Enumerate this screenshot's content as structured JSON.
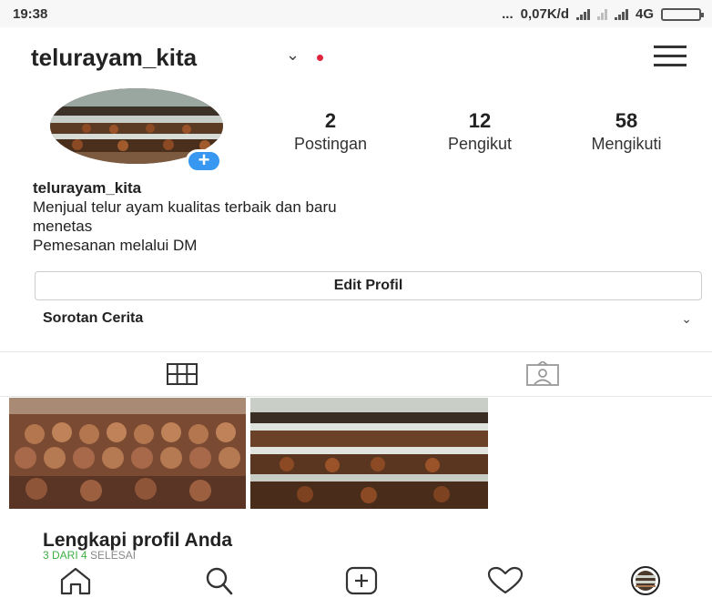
{
  "status_bar": {
    "time": "19:38",
    "dots": "...",
    "speed": "0,07K/d",
    "network": "4G"
  },
  "header": {
    "username": "telurayam_kita",
    "chevron": "⌄"
  },
  "profile": {
    "add_story": "+",
    "stats": [
      {
        "count": "2",
        "label": "Postingan"
      },
      {
        "count": "12",
        "label": "Pengikut"
      },
      {
        "count": "58",
        "label": "Mengikuti"
      }
    ],
    "bio_name": "telurayam_kita",
    "bio_lines": [
      "Menjual telur ayam kualitas terbaik dan baru",
      "menetas",
      "Pemesanan melalui DM"
    ],
    "edit_label": "Edit Profil"
  },
  "highlights": {
    "label": "Sorotan Cerita",
    "chevron": "⌄"
  },
  "complete_profile": {
    "title": "Lengkapi profil Anda",
    "progress_green": "3 DARI 4",
    "progress_rest": "SELESAI"
  },
  "colors": {
    "accent_blue": "#3897f0",
    "notification_red": "#e0243b",
    "progress_green": "#3cb043"
  },
  "icons": {
    "menu": "hamburger-menu-icon",
    "grid": "grid-icon",
    "tagged": "tagged-person-icon",
    "home": "home-icon",
    "search": "search-icon",
    "add": "add-post-icon",
    "activity": "heart-icon",
    "profile": "profile-avatar-icon"
  }
}
